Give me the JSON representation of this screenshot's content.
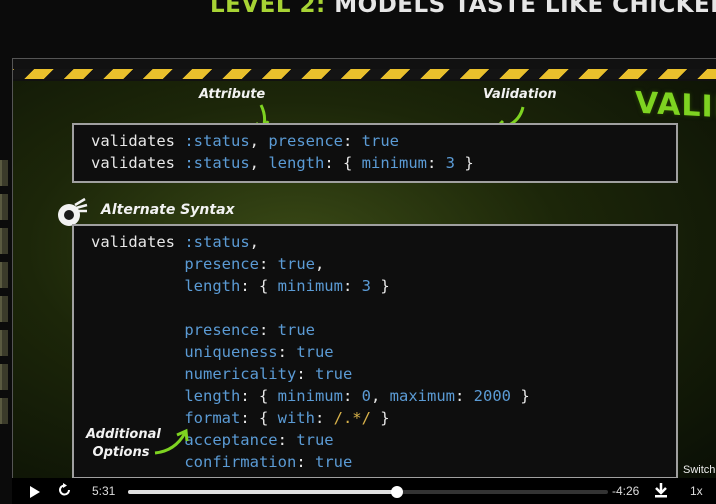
{
  "page": {
    "title_level": "LEVEL 2:",
    "title_rest": "MODELS TASTE LIKE CHICKEN"
  },
  "slide": {
    "annotations": {
      "attribute": "Attribute",
      "validation": "Validation",
      "alternate_syntax": "Alternate Syntax",
      "additional_options": "Additional Options"
    },
    "sign_text": "VALIDA",
    "box1_lines": [
      [
        {
          "t": "validates ",
          "c": ""
        },
        {
          "t": ":status",
          "c": "sym"
        },
        {
          "t": ", ",
          "c": ""
        },
        {
          "t": "presence",
          "c": "sym"
        },
        {
          "t": ": ",
          "c": ""
        },
        {
          "t": "true",
          "c": "sym"
        }
      ],
      [
        {
          "t": "validates ",
          "c": ""
        },
        {
          "t": ":status",
          "c": "sym"
        },
        {
          "t": ", ",
          "c": ""
        },
        {
          "t": "length",
          "c": "sym"
        },
        {
          "t": ": { ",
          "c": ""
        },
        {
          "t": "minimum",
          "c": "sym"
        },
        {
          "t": ": ",
          "c": ""
        },
        {
          "t": "3",
          "c": "num"
        },
        {
          "t": " }",
          "c": ""
        }
      ]
    ],
    "box2_lines": [
      [
        {
          "t": "validates ",
          "c": ""
        },
        {
          "t": ":status",
          "c": "sym"
        },
        {
          "t": ",",
          "c": ""
        }
      ],
      [
        {
          "t": "          presence",
          "c": "sym"
        },
        {
          "t": ": ",
          "c": ""
        },
        {
          "t": "true",
          "c": "sym"
        },
        {
          "t": ",",
          "c": ""
        }
      ],
      [
        {
          "t": "          length",
          "c": "sym"
        },
        {
          "t": ": { ",
          "c": ""
        },
        {
          "t": "minimum",
          "c": "sym"
        },
        {
          "t": ": ",
          "c": ""
        },
        {
          "t": "3",
          "c": "num"
        },
        {
          "t": " }",
          "c": ""
        }
      ],
      [
        {
          "t": "",
          "c": ""
        }
      ],
      [
        {
          "t": "          presence",
          "c": "sym"
        },
        {
          "t": ": ",
          "c": ""
        },
        {
          "t": "true",
          "c": "sym"
        }
      ],
      [
        {
          "t": "          uniqueness",
          "c": "sym"
        },
        {
          "t": ": ",
          "c": ""
        },
        {
          "t": "true",
          "c": "sym"
        }
      ],
      [
        {
          "t": "          numericality",
          "c": "sym"
        },
        {
          "t": ": ",
          "c": ""
        },
        {
          "t": "true",
          "c": "sym"
        }
      ],
      [
        {
          "t": "          length",
          "c": "sym"
        },
        {
          "t": ": { ",
          "c": ""
        },
        {
          "t": "minimum",
          "c": "sym"
        },
        {
          "t": ": ",
          "c": ""
        },
        {
          "t": "0",
          "c": "num"
        },
        {
          "t": ", ",
          "c": ""
        },
        {
          "t": "maximum",
          "c": "sym"
        },
        {
          "t": ": ",
          "c": ""
        },
        {
          "t": "2000",
          "c": "num"
        },
        {
          "t": " }",
          "c": ""
        }
      ],
      [
        {
          "t": "          format",
          "c": "sym"
        },
        {
          "t": ": { ",
          "c": ""
        },
        {
          "t": "with",
          "c": "sym"
        },
        {
          "t": ": ",
          "c": ""
        },
        {
          "t": "/.*/",
          "c": "re"
        },
        {
          "t": " }",
          "c": ""
        }
      ],
      [
        {
          "t": "          acceptance",
          "c": "sym"
        },
        {
          "t": ": ",
          "c": ""
        },
        {
          "t": "true",
          "c": "sym"
        }
      ],
      [
        {
          "t": "          confirmation",
          "c": "sym"
        },
        {
          "t": ": ",
          "c": ""
        },
        {
          "t": "true",
          "c": "sym"
        }
      ]
    ]
  },
  "player": {
    "current_time": "5:31",
    "remaining_time": "-4:26",
    "progress_fraction": 0.56,
    "speed": "1x",
    "switch_label": "Switch",
    "icons": [
      "play-icon",
      "replay-icon",
      "download-icon"
    ]
  },
  "colors": {
    "accent_green": "#a7d334",
    "code_symbol_blue": "#5b9bd5",
    "code_regex_gold": "#d9b34a",
    "hazard_yellow": "#e9c02c"
  }
}
